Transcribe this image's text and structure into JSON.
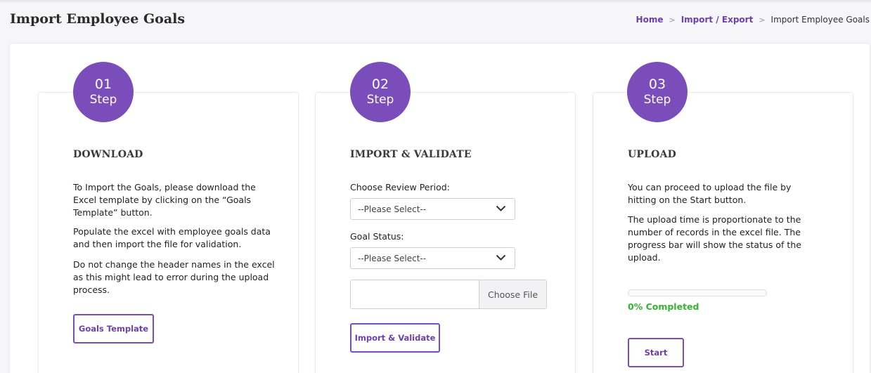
{
  "page": {
    "title": "Import Employee Goals"
  },
  "breadcrumb": {
    "items": [
      "Home",
      "Import / Export"
    ],
    "current": "Import Employee Goals",
    "separator": ">"
  },
  "colors": {
    "accent": "#7b4dbb",
    "link": "#6d3fb0",
    "success": "#35b52f"
  },
  "steps": [
    {
      "num": "01",
      "label": "Step",
      "title": "DOWNLOAD",
      "paragraphs": [
        "To Import the Goals, please download the Excel template by clicking on the “Goals Template” button.",
        "Populate the excel with employee goals data and then import the file for validation.",
        "Do not change the header names in the excel as this might lead to error during the upload process."
      ],
      "button": "Goals Template"
    },
    {
      "num": "02",
      "label": "Step",
      "title": "IMPORT & VALIDATE",
      "review_period_label": "Choose Review Period:",
      "review_period_value": "--Please Select--",
      "goal_status_label": "Goal Status:",
      "goal_status_value": "--Please Select--",
      "file_button": "Choose File",
      "button": "Import & Validate"
    },
    {
      "num": "03",
      "label": "Step",
      "title": "UPLOAD",
      "paragraphs": [
        "You can proceed to upload the file by hitting on the Start button.",
        "The upload time is proportionate to the number of records in the excel file. The progress bar will show the status of the upload."
      ],
      "progress_value": 0,
      "progress_text": "0% Completed",
      "button": "Start"
    }
  ]
}
